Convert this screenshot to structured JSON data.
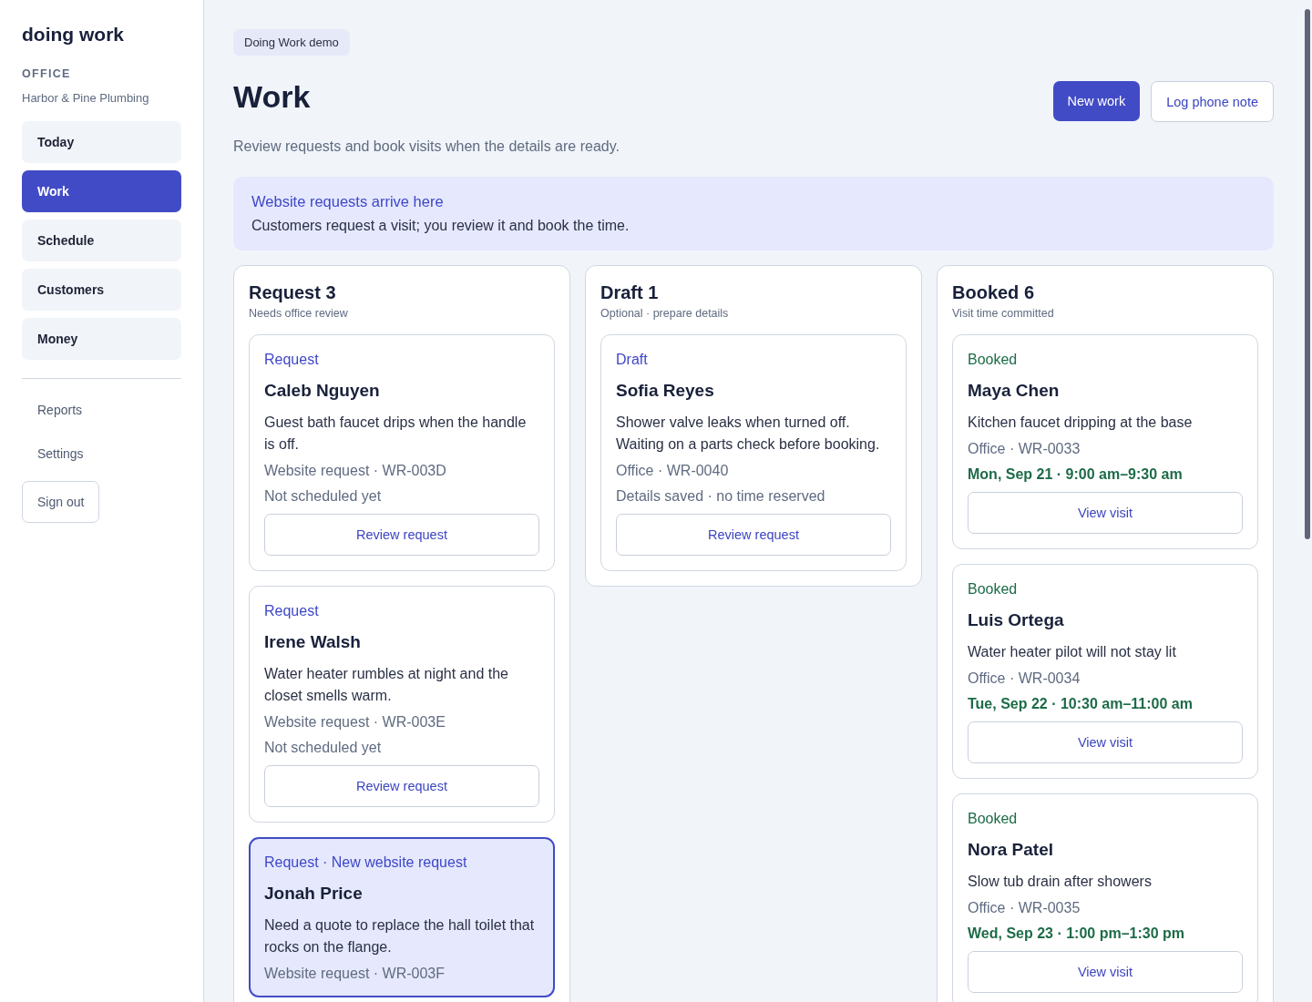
{
  "sidebar": {
    "brand": "doing work",
    "section_label": "OFFICE",
    "company": "Harbor & Pine Plumbing",
    "nav": [
      {
        "label": "Today",
        "selected": false
      },
      {
        "label": "Work",
        "selected": true
      },
      {
        "label": "Schedule",
        "selected": false
      },
      {
        "label": "Customers",
        "selected": false
      },
      {
        "label": "Money",
        "selected": false
      }
    ],
    "links": [
      "Reports",
      "Settings"
    ],
    "sign_out": "Sign out"
  },
  "header": {
    "badge": "Doing Work demo",
    "title": "Work",
    "subtitle": "Review requests and book visits when the details are ready.",
    "buttons": [
      {
        "label": "New work",
        "kind": "primary"
      },
      {
        "label": "Log phone note",
        "kind": "secondary"
      }
    ]
  },
  "notice": {
    "title": "Website requests arrive here",
    "text": "Customers request a visit; you review it and book the time."
  },
  "columns": [
    {
      "title": "Request 3",
      "subtitle": "Needs office review",
      "cards": [
        {
          "kind": "request",
          "highlighted": false,
          "tag": "Request",
          "name": "Caleb Nguyen",
          "description": "Guest bath faucet drips when the handle is off.",
          "source": "Website request · WR-003D",
          "schedule": "Not scheduled yet",
          "action": "Review request"
        },
        {
          "kind": "request",
          "highlighted": false,
          "tag": "Request",
          "name": "Irene Walsh",
          "description": "Water heater rumbles at night and the closet smells warm.",
          "source": "Website request · WR-003E",
          "schedule": "Not scheduled yet",
          "action": "Review request"
        },
        {
          "kind": "request",
          "highlighted": true,
          "tag": "Request · New website request",
          "name": "Jonah Price",
          "description": "Need a quote to replace the hall toilet that rocks on the flange.",
          "source": "Website request · WR-003F"
        }
      ]
    },
    {
      "title": "Draft 1",
      "subtitle": "Optional · prepare details",
      "cards": [
        {
          "kind": "draft",
          "highlighted": false,
          "tag": "Draft",
          "name": "Sofia Reyes",
          "description": "Shower valve leaks when turned off. Waiting on a parts check before booking.",
          "source": "Office · WR-0040",
          "schedule": "Details saved · no time reserved",
          "action": "Review request"
        }
      ]
    },
    {
      "title": "Booked 6",
      "subtitle": "Visit time committed",
      "cards": [
        {
          "kind": "booked",
          "highlighted": false,
          "tag": "Booked",
          "name": "Maya Chen",
          "description": "Kitchen faucet dripping at the base",
          "source": "Office · WR-0033",
          "schedule": "Mon, Sep 21 · 9:00 am–9:30 am",
          "action": "View visit"
        },
        {
          "kind": "booked",
          "highlighted": false,
          "tag": "Booked",
          "name": "Luis Ortega",
          "description": "Water heater pilot will not stay lit",
          "source": "Office · WR-0034",
          "schedule": "Tue, Sep 22 · 10:30 am–11:00 am",
          "action": "View visit"
        },
        {
          "kind": "booked",
          "highlighted": false,
          "tag": "Booked",
          "name": "Nora Patel",
          "description": "Slow tub drain after showers",
          "source": "Office · WR-0035",
          "schedule": "Wed, Sep 23 · 1:00 pm–1:30 pm",
          "action": "View visit"
        }
      ]
    }
  ]
}
